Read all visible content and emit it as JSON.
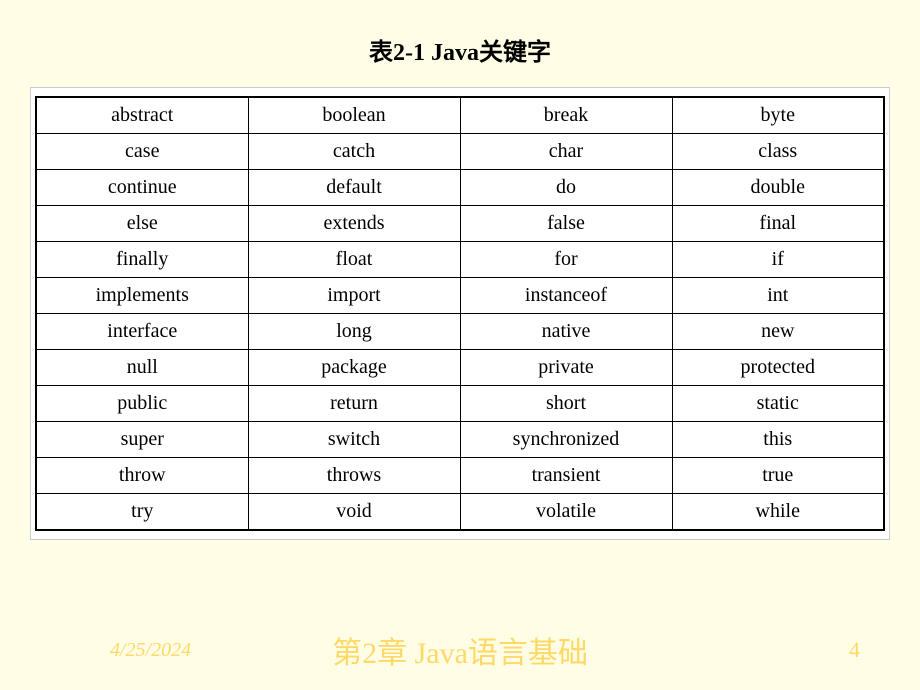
{
  "title": "表2-1  Java关键字",
  "table": {
    "rows": [
      [
        "abstract",
        "boolean",
        "break",
        "byte"
      ],
      [
        "case",
        "catch",
        "char",
        "class"
      ],
      [
        "continue",
        "default",
        "do",
        "double"
      ],
      [
        "else",
        "extends",
        "false",
        "final"
      ],
      [
        "finally",
        "float",
        "for",
        "if"
      ],
      [
        "implements",
        "import",
        "instanceof",
        "int"
      ],
      [
        "interface",
        "long",
        "native",
        "new"
      ],
      [
        "null",
        "package",
        "private",
        "protected"
      ],
      [
        "public",
        "return",
        "short",
        "static"
      ],
      [
        "super",
        "switch",
        "synchronized",
        "this"
      ],
      [
        "throw",
        "throws",
        "transient",
        "true"
      ],
      [
        "try",
        "void",
        "volatile",
        "while"
      ]
    ]
  },
  "footer": {
    "date": "4/25/2024",
    "chapter": "第2章  Java语言基础",
    "page": "4"
  }
}
